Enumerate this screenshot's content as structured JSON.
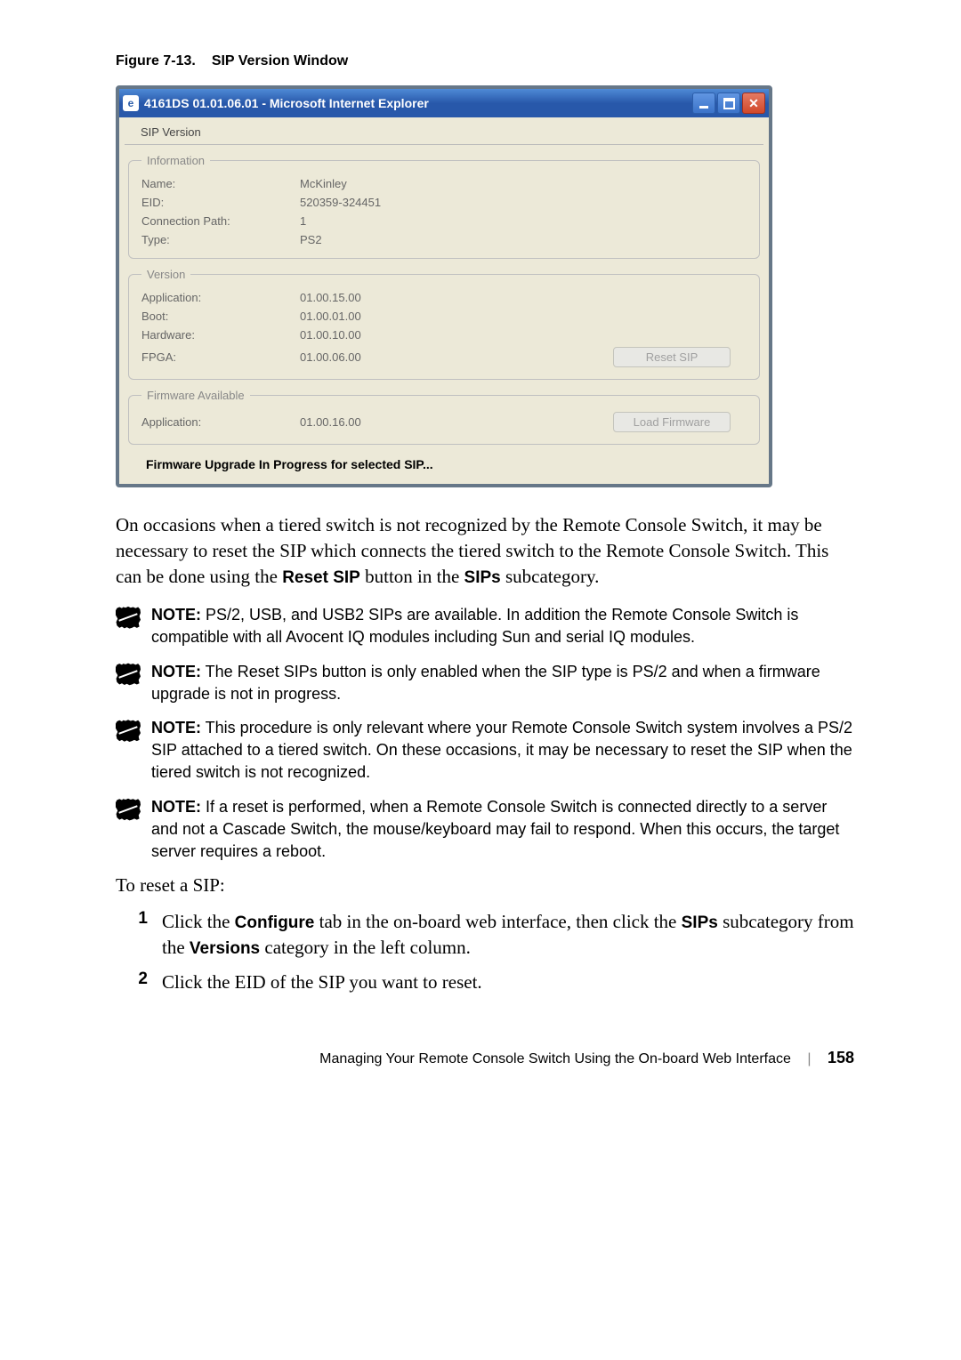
{
  "figure": {
    "label": "Figure 7-13.",
    "title": "SIP Version Window"
  },
  "window": {
    "title": "4161DS 01.01.06.01 - Microsoft Internet Explorer",
    "tab": "SIP Version",
    "information": {
      "legend": "Information",
      "name_label": "Name:",
      "name_value": "McKinley",
      "eid_label": "EID:",
      "eid_value": "520359-324451",
      "conn_label": "Connection Path:",
      "conn_value": "1",
      "type_label": "Type:",
      "type_value": "PS2"
    },
    "version": {
      "legend": "Version",
      "app_label": "Application:",
      "app_value": "01.00.15.00",
      "boot_label": "Boot:",
      "boot_value": "01.00.01.00",
      "hw_label": "Hardware:",
      "hw_value": "01.00.10.00",
      "fpga_label": "FPGA:",
      "fpga_value": "01.00.06.00",
      "reset_btn": "Reset SIP"
    },
    "firmware": {
      "legend": "Firmware Available",
      "app_label": "Application:",
      "app_value": "01.00.16.00",
      "load_btn": "Load Firmware"
    },
    "status": "Firmware Upgrade In Progress for selected SIP..."
  },
  "para1": {
    "t1": "On occasions when a tiered switch is not recognized by the Remote Console Switch, it may be necessary to reset the SIP which connects the tiered switch to the Remote Console Switch. This can be done using the ",
    "b1": "Reset SIP",
    "t2": " button in the ",
    "b2": "SIPs",
    "t3": " subcategory."
  },
  "notes": {
    "n1": {
      "label": "NOTE:",
      "text": " PS/2, USB, and USB2 SIPs are available. In addition the Remote Console Switch is compatible with all Avocent IQ modules including Sun and serial IQ modules."
    },
    "n2": {
      "label": "NOTE:",
      "text": " The Reset SIPs button is only enabled when the SIP type is PS/2 and when a firmware upgrade is not in progress."
    },
    "n3": {
      "label": "NOTE:",
      "text": " This procedure is only relevant where your Remote Console Switch system involves a PS/2 SIP attached to a tiered switch. On these occasions, it may be necessary to reset the SIP when the tiered switch is not recognized."
    },
    "n4": {
      "label": "NOTE:",
      "text": " If a reset is performed, when a Remote Console Switch is connected directly to a server and not a Cascade Switch, the mouse/keyboard may fail to respond. When this occurs, the target server requires a reboot."
    }
  },
  "to_reset": "To reset a SIP:",
  "steps": {
    "s1": {
      "num": "1",
      "t1": "Click the ",
      "b1": "Configure",
      "t2": " tab in the on-board web interface, then click the ",
      "b2": "SIPs",
      "t3": " subcategory from the ",
      "b3": "Versions",
      "t4": " category in the left column."
    },
    "s2": {
      "num": "2",
      "t1": "Click the EID of the SIP you want to reset."
    }
  },
  "footer": {
    "text": "Managing Your Remote Console Switch Using the On-board Web Interface",
    "page": "158"
  }
}
